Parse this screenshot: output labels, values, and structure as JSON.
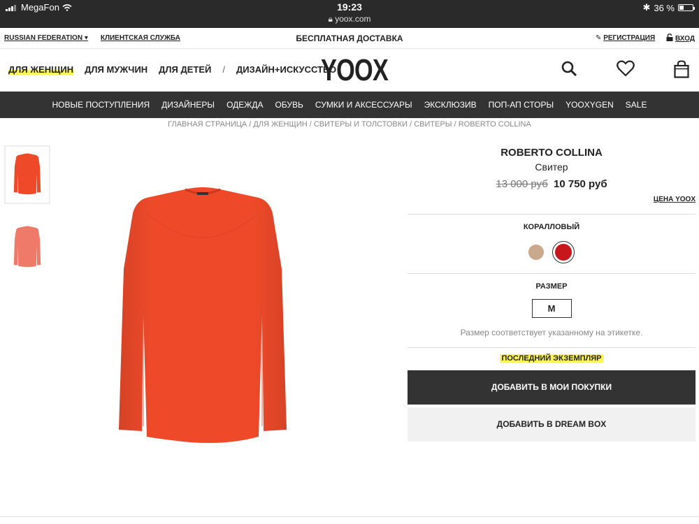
{
  "status_bar": {
    "carrier": "MegaFon",
    "time": "19:23",
    "url": "yoox.com",
    "battery": "36 %",
    "battery_fraction": 0.36
  },
  "util_bar": {
    "country": "RUSSIAN FEDERATION",
    "service": "КЛИЕНТСКАЯ СЛУЖБА",
    "promo": "БЕСПЛАТНАЯ ДОСТАВКА",
    "register": "РЕГИСТРАЦИЯ",
    "login": "ВХОД"
  },
  "header": {
    "nav": [
      "ДЛЯ ЖЕНЩИН",
      "ДЛЯ МУЖЧИН",
      "ДЛЯ ДЕТЕЙ",
      "ДИЗАЙН+ИСКУССТВО"
    ],
    "separator": "/",
    "logo": "YOOX",
    "icons": [
      "search-icon",
      "heart-icon",
      "bag-icon"
    ]
  },
  "categories": [
    "НОВЫЕ ПОСТУПЛЕНИЯ",
    "ДИЗАЙНЕРЫ",
    "ОДЕЖДА",
    "ОБУВЬ",
    "СУМКИ И АКСЕССУАРЫ",
    "ЭКСКЛЮЗИВ",
    "ПОП-АП СТОРЫ",
    "YOOXYGEN",
    "SALE"
  ],
  "breadcrumb": "ГЛАВНАЯ СТРАНИЦА / ДЛЯ ЖЕНЩИН / СВИТЕРЫ И ТОЛСТОВКИ / СВИТЕРЫ / ROBERTO COLLINA",
  "product": {
    "brand": "ROBERTO COLLINA",
    "type": "Свитер",
    "old_price": "13 000 руб",
    "new_price": "10 750 руб",
    "price_link": "ЦЕНА YOOX",
    "color_label": "КОРАЛЛОВЫЙ",
    "colors": [
      "#c9a88c",
      "#c8161d"
    ],
    "size_label": "РАЗМЕР",
    "size": "M",
    "size_note": "Размер соответствует указанному на этикетке.",
    "last_item": "ПОСЛЕДНИЙ ЭКЗЕМПЛЯР",
    "add_to_cart": "ДОБАВИТЬ В МОИ ПОКУПКИ",
    "add_to_dreambox": "ДОБАВИТЬ В DREAM BOX",
    "main_color": "#ee4a2a"
  }
}
